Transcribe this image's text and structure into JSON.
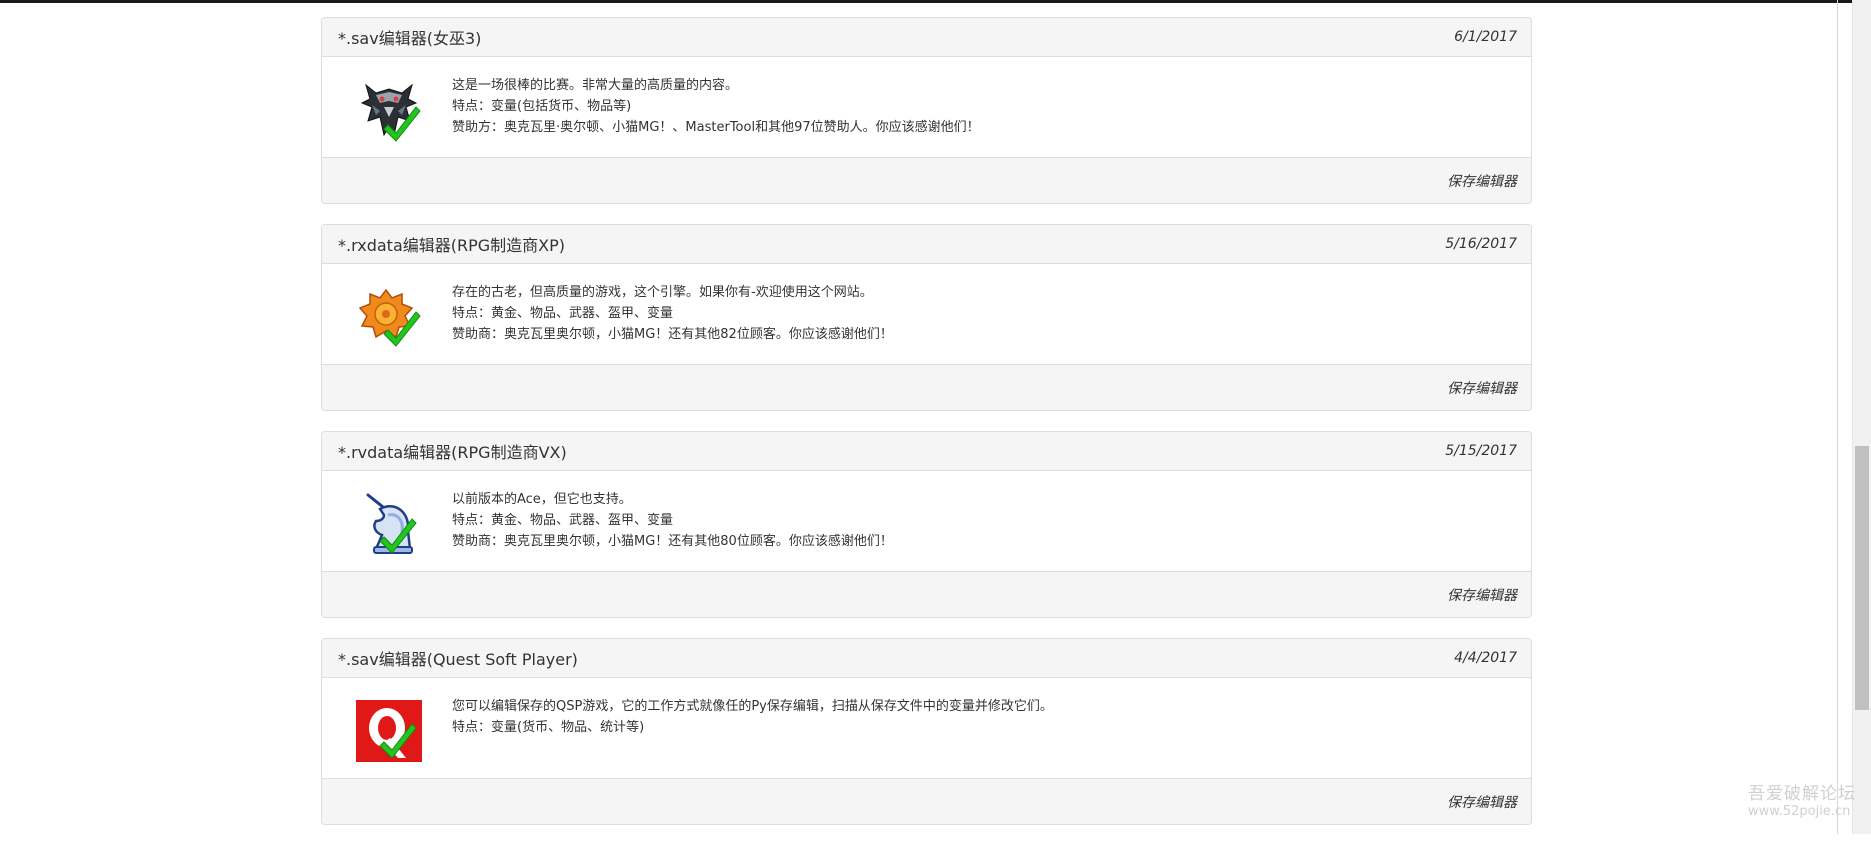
{
  "editors": [
    {
      "title": "*.sav编辑器(女巫3)",
      "date": "6/1/2017",
      "icon": "witcher-wolf-icon",
      "lines": [
        "这是一场很棒的比赛。非常大量的高质量的内容。",
        "特点：变量(包括货币、物品等)",
        "赞助方：奥克瓦里·奥尔顿、小猫MG！、MasterTool和其他97位赞助人。你应该感谢他们！"
      ],
      "footer": "保存编辑器"
    },
    {
      "title": "*.rxdata编辑器(RPG制造商XP)",
      "date": "5/16/2017",
      "icon": "orange-gear-icon",
      "lines": [
        "存在的古老，但高质量的游戏，这个引擎。如果你有-欢迎使用这个网站。",
        "特点：黄金、物品、武器、盔甲、变量",
        "赞助商：奥克瓦里奥尔顿，小猫MG！还有其他82位顾客。你应该感谢他们！"
      ],
      "footer": "保存编辑器"
    },
    {
      "title": "*.rvdata编辑器(RPG制造商VX)",
      "date": "5/15/2017",
      "icon": "unicorn-chess-icon",
      "lines": [
        "以前版本的Ace，但它也支持。",
        "特点：黄金、物品、武器、盔甲、变量",
        "赞助商：奥克瓦里奥尔顿，小猫MG！还有其他80位顾客。你应该感谢他们！"
      ],
      "footer": "保存编辑器"
    },
    {
      "title": "*.sav编辑器(Quest Soft Player)",
      "date": "4/4/2017",
      "icon": "qsp-logo-icon",
      "lines": [
        "您可以编辑保存的QSP游戏，它的工作方式就像任的Py保存编辑，扫描从保存文件中的变量并修改它们。",
        "特点：变量(货币、物品、统计等)"
      ],
      "footer": "保存编辑器"
    }
  ],
  "watermark": {
    "line1": "吾爱破解论坛",
    "line2": "www.52pojie.cn"
  },
  "colors": {
    "panel_border": "#dddddd",
    "panel_header_bg": "#f5f5f5",
    "check_green": "#22c51e"
  }
}
